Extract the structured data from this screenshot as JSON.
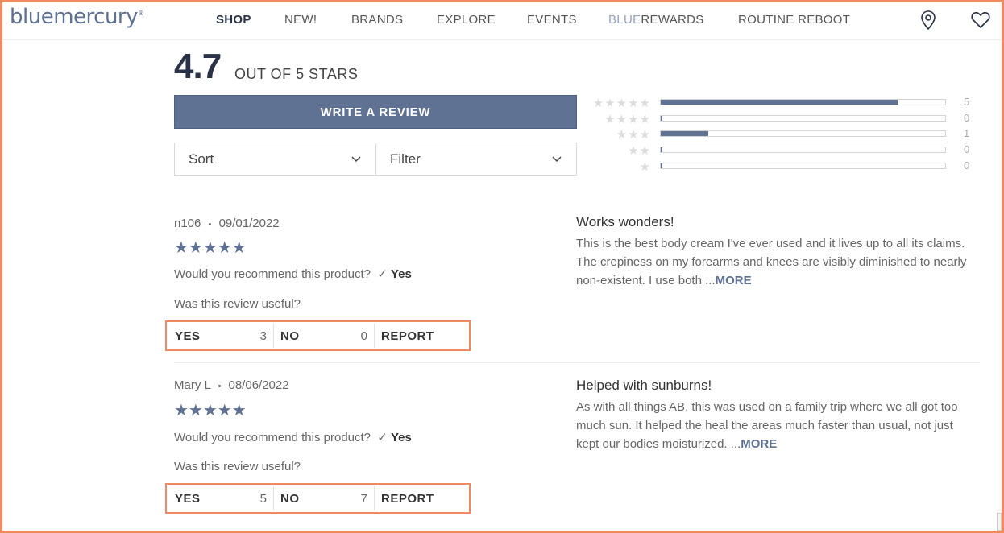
{
  "header": {
    "logo": "bluemercury",
    "logo_mark": "®",
    "nav": [
      {
        "label": "SHOP"
      },
      {
        "label": "NEW!"
      },
      {
        "label": "BRANDS"
      },
      {
        "label": "EXPLORE"
      },
      {
        "label": "EVENTS"
      },
      {
        "label_blue": "BLUE",
        "label_rest": "REWARDS"
      },
      {
        "label": "ROUTINE REBOOT"
      }
    ],
    "icons": [
      "location-pin-icon",
      "heart-icon"
    ]
  },
  "summary": {
    "rating": "4.7",
    "out_of": "OUT OF 5 STARS",
    "write_review": "WRITE A REVIEW",
    "sort_label": "Sort",
    "filter_label": "Filter",
    "histogram": [
      {
        "stars": "★★★★★",
        "count": "5",
        "fraction": 0.833
      },
      {
        "stars": "★★★★",
        "count": "0",
        "fraction": 0.0
      },
      {
        "stars": "★★★",
        "count": "1",
        "fraction": 0.167
      },
      {
        "stars": "★★",
        "count": "0",
        "fraction": 0.0
      },
      {
        "stars": "★",
        "count": "0",
        "fraction": 0.0
      }
    ]
  },
  "reviews": [
    {
      "author": "n106",
      "separator": "•",
      "date": "09/01/2022",
      "stars": "★★★★★",
      "recommend_q": "Would you recommend this product?",
      "recommend_a": "Yes",
      "useful_q": "Was this review useful?",
      "yes_label": "YES",
      "yes_count": "3",
      "no_label": "NO",
      "no_count": "0",
      "report_label": "REPORT",
      "title": "Works wonders!",
      "body": "This is the best body cream I've ever used and it lives up to all its claims. The crepiness on my forearms and knees are visibly diminished to nearly non-existent. I use both ...",
      "more": "MORE"
    },
    {
      "author": "Mary L",
      "separator": "•",
      "date": "08/06/2022",
      "stars": "★★★★★",
      "recommend_q": "Would you recommend this product?",
      "recommend_a": "Yes",
      "useful_q": "Was this review useful?",
      "yes_label": "YES",
      "yes_count": "5",
      "no_label": "NO",
      "no_count": "7",
      "report_label": "REPORT",
      "title": "Helped with sunburns!",
      "body": "As with all things AB, this was used on a family trip where we all got too much sun. It helped the heal the areas much faster than usual, not just kept our bodies moisturized. ...",
      "more": "MORE"
    }
  ],
  "colors": {
    "accent": "#5f7293",
    "highlight": "#ef8a62",
    "text_dark": "#2a3247"
  }
}
